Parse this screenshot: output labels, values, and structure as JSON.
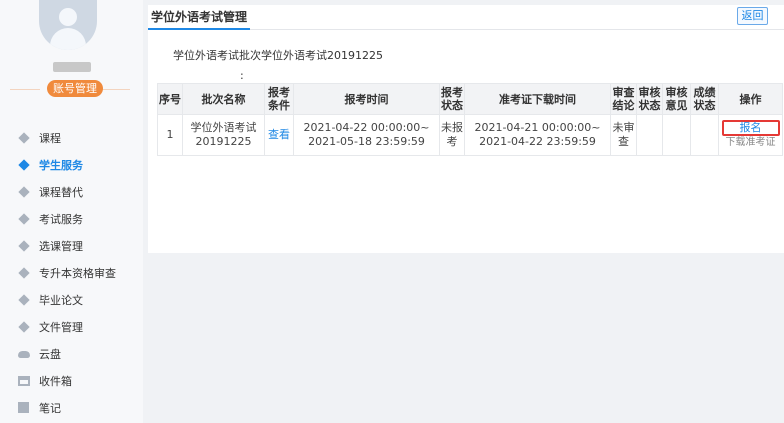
{
  "sidebar": {
    "account_button": "账号管理",
    "items": [
      {
        "label": "课程",
        "icon": "diamond-icon",
        "active": false
      },
      {
        "label": "学生服务",
        "icon": "diamond-icon",
        "active": true
      },
      {
        "label": "课程替代",
        "icon": "diamond-icon",
        "active": false
      },
      {
        "label": "考试服务",
        "icon": "diamond-icon",
        "active": false
      },
      {
        "label": "选课管理",
        "icon": "diamond-icon",
        "active": false
      },
      {
        "label": "专升本资格审查",
        "icon": "diamond-icon",
        "active": false
      },
      {
        "label": "毕业论文",
        "icon": "diamond-icon",
        "active": false
      },
      {
        "label": "文件管理",
        "icon": "diamond-icon",
        "active": false
      },
      {
        "label": "云盘",
        "icon": "cloud-icon",
        "active": false
      },
      {
        "label": "收件箱",
        "icon": "inbox-icon",
        "active": false
      },
      {
        "label": "笔记",
        "icon": "note-icon",
        "active": false
      }
    ]
  },
  "main": {
    "tab_title": "学位外语考试管理",
    "back_label": "返回",
    "batch_title": "学位外语考试批次学位外语考试20191225",
    "colon": ":",
    "table": {
      "headers": [
        "序号",
        "批次名称",
        "报考条件",
        "报考时间",
        "报考状态",
        "准考证下载时间",
        "审查结论",
        "审核状态",
        "审核意见",
        "成绩状态",
        "操作"
      ],
      "rows": [
        {
          "index": "1",
          "name": "学位外语考试20191225",
          "condition_link": "查看",
          "signup_time": "2021-04-22 00:00:00~ 2021-05-18 23:59:59",
          "signup_status": "未报考",
          "download_time": "2021-04-21 00:00:00~ 2021-04-22 23:59:59",
          "review_result": "未审查",
          "audit_status": "",
          "audit_opinion": "",
          "score_status": "",
          "action_signup": "报名",
          "action_download": "下载准考证"
        }
      ]
    }
  },
  "colors": {
    "accent": "#1e88e5",
    "account_button": "#f08a3c",
    "highlight_border": "#e53935"
  }
}
